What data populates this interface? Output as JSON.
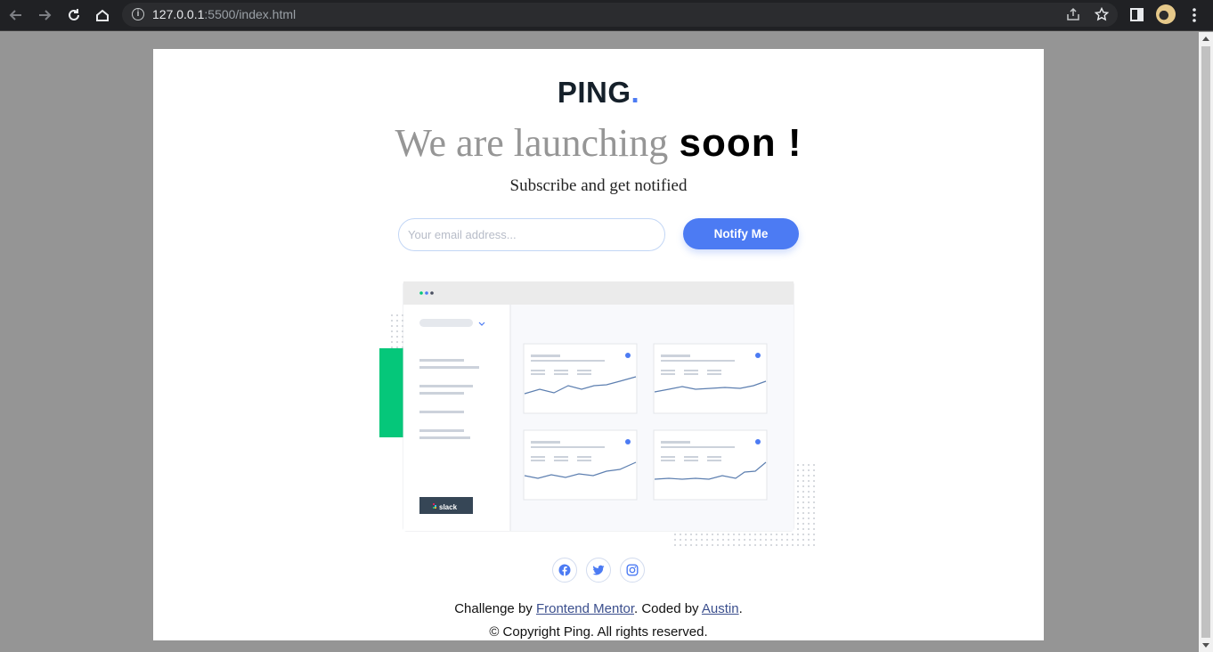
{
  "browser": {
    "url_host": "127.0.0.1",
    "url_rest": ":5500/index.html"
  },
  "page": {
    "logo_text": "PING",
    "logo_dot": ".",
    "headline_light": "We are launching",
    "headline_bold": "soon !",
    "subtitle": "Subscribe and get notified",
    "email_placeholder": "Your email address...",
    "email_value": "",
    "notify_label": "Notify Me",
    "illustration_label": "slack",
    "footer": {
      "challenge_prefix": "Challenge by",
      "challenge_link": "Frontend Mentor",
      "coded_prefix": ". Coded by",
      "coded_link": "Austin",
      "coded_suffix": ".",
      "copyright": "© Copyright Ping. All rights reserved."
    }
  },
  "colors": {
    "brand_blue": "#4c7bf3",
    "accent_green": "#05c77a",
    "dark": "#15202a"
  },
  "icons": [
    "back-icon",
    "forward-icon",
    "reload-icon",
    "home-icon",
    "info-icon",
    "share-icon",
    "star-icon",
    "side-panel-icon",
    "menu-icon",
    "facebook-icon",
    "twitter-icon",
    "instagram-icon"
  ]
}
